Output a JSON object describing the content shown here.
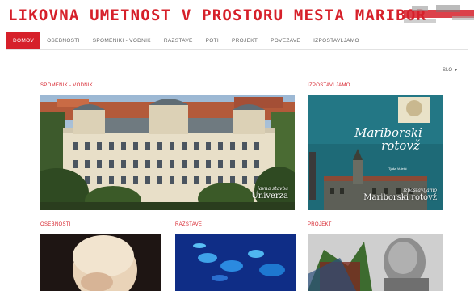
{
  "site": {
    "title": "LIKOVNA UMETNOST V PROSTORU MESTA MARIBOR"
  },
  "nav": {
    "items": [
      {
        "label": "DOMOV",
        "active": true
      },
      {
        "label": "OSEBNOSTI",
        "active": false
      },
      {
        "label": "SPOMENIKI - VODNIK",
        "active": false
      },
      {
        "label": "RAZSTAVE",
        "active": false
      },
      {
        "label": "POTI",
        "active": false
      },
      {
        "label": "PROJEKT",
        "active": false
      },
      {
        "label": "POVEZAVE",
        "active": false
      },
      {
        "label": "IZPOSTAVLJAMO",
        "active": false
      }
    ]
  },
  "language": {
    "selected": "SLO",
    "caret_icon": "caret-down-icon"
  },
  "sections": {
    "spomenik": {
      "label": "SPOMENIK - VODNIK",
      "caption_small": "javna stavba",
      "caption_big": "Univerza"
    },
    "izpostavljamo": {
      "label": "IZPOSTAVLJAMO",
      "cover_title_line1": "Mariborski",
      "cover_title_line2": "rotovž",
      "cover_author": "Tjaša Vuletić",
      "caption_small": "izpostavljamo",
      "caption_big": "Mariborski rotovž"
    },
    "osebnosti": {
      "label": "OSEBNOSTI"
    },
    "razstave": {
      "label": "RAZSTAVE"
    },
    "projekt": {
      "label": "PROJEKT"
    }
  },
  "colors": {
    "accent": "#d6202a"
  }
}
